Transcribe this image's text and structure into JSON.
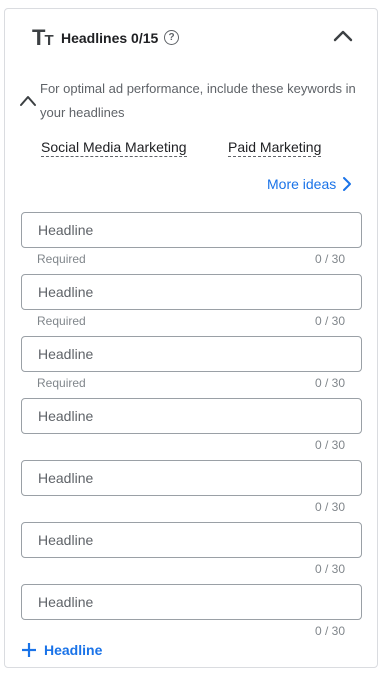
{
  "header": {
    "icon_big": "T",
    "icon_small": "T",
    "title": "Headlines 0/15",
    "help_glyph": "?"
  },
  "suggestions": {
    "text": "For optimal ad performance, include these keywords in your headlines",
    "keywords": [
      "Social Media Marketing",
      "Paid Marketing"
    ],
    "more_label": "More ideas"
  },
  "headlines": [
    {
      "placeholder": "Headline",
      "value": "",
      "hint": "Required",
      "count": "0 / 30"
    },
    {
      "placeholder": "Headline",
      "value": "",
      "hint": "Required",
      "count": "0 / 30"
    },
    {
      "placeholder": "Headline",
      "value": "",
      "hint": "Required",
      "count": "0 / 30"
    },
    {
      "placeholder": "Headline",
      "value": "",
      "hint": "",
      "count": "0 / 30"
    },
    {
      "placeholder": "Headline",
      "value": "",
      "hint": "",
      "count": "0 / 30"
    },
    {
      "placeholder": "Headline",
      "value": "",
      "hint": "",
      "count": "0 / 30"
    },
    {
      "placeholder": "Headline",
      "value": "",
      "hint": "",
      "count": "0 / 30"
    }
  ],
  "add_button": {
    "label": "Headline"
  },
  "icons": {
    "title": "text-size-icon",
    "help": "help-icon",
    "collapse": "chevron-up-icon",
    "suggest": "chevron-up-icon",
    "more": "chevron-right-icon",
    "add": "plus-icon"
  },
  "colors": {
    "accent": "#1a73e8",
    "border": "#9aa0a6",
    "muted": "#5f6368"
  }
}
